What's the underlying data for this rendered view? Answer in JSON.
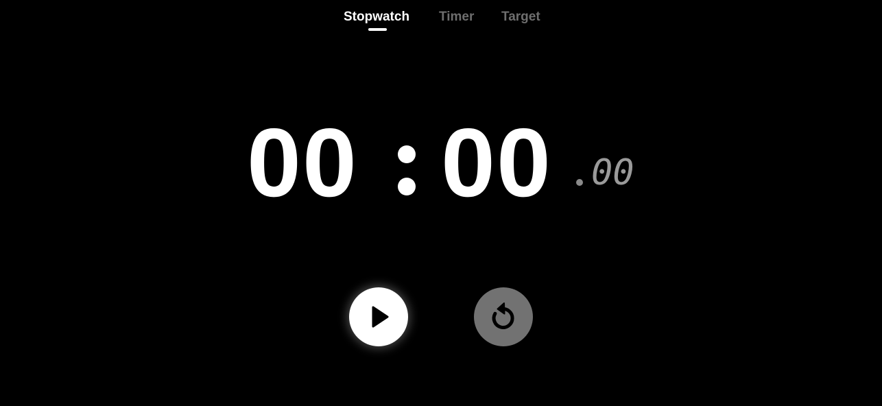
{
  "tabs": {
    "items": [
      {
        "label": "Stopwatch",
        "active": true
      },
      {
        "label": "Timer",
        "active": false
      },
      {
        "label": "Target",
        "active": false
      }
    ]
  },
  "display": {
    "minutes": "00",
    "seconds": "00",
    "centiseconds": "00"
  },
  "controls": {
    "play_icon": "play-icon",
    "reset_icon": "reset-icon"
  },
  "colors": {
    "background": "#000000",
    "primary_text": "#ffffff",
    "inactive_tab": "#6e6e6e",
    "centiseconds": "#9a9a9a",
    "reset_button": "#727272"
  }
}
